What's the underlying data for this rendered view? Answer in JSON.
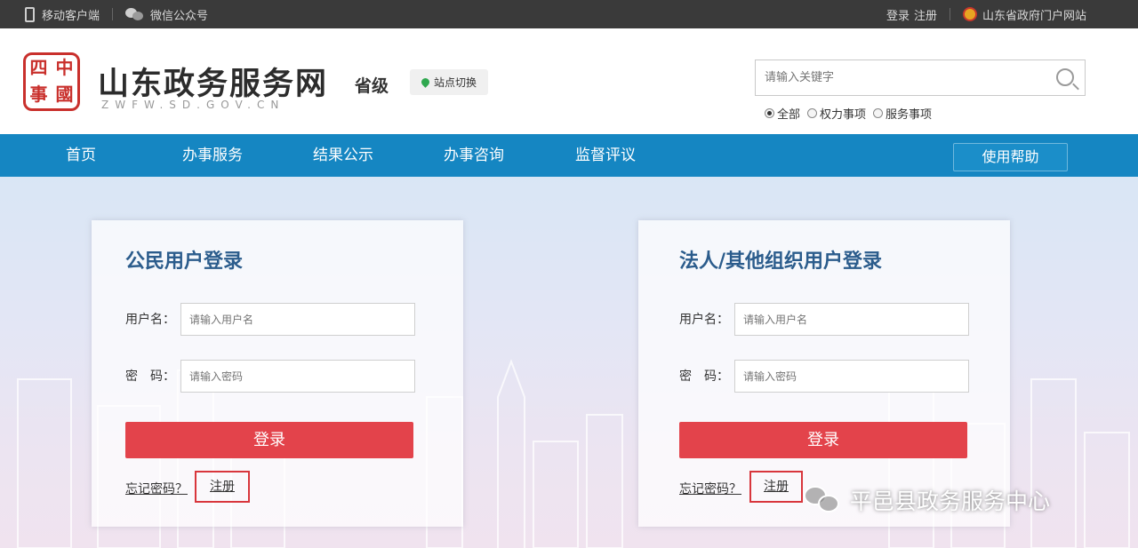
{
  "topbar": {
    "mobile_client": "移动客户端",
    "wechat": "微信公众号",
    "login": "登录",
    "register": "注册",
    "portal": "山东省政府门户网站"
  },
  "header": {
    "seal_chars": [
      "中",
      "國",
      "四",
      "事"
    ],
    "site_name": "山东政务服务网",
    "site_sub": "ZWFW.SD.GOV.CN",
    "level": "省级",
    "switch_label": "站点切换",
    "search_placeholder": "请输入关键字",
    "radios": [
      {
        "label": "全部",
        "checked": true
      },
      {
        "label": "权力事项",
        "checked": false
      },
      {
        "label": "服务事项",
        "checked": false
      }
    ]
  },
  "nav": {
    "items": [
      "首页",
      "办事服务",
      "结果公示",
      "办事咨询",
      "监督评议"
    ],
    "help": "使用帮助"
  },
  "citizen": {
    "title": "公民用户登录",
    "username_label": "用户名：",
    "username_placeholder": "请输入用户名",
    "password_label": "密　码：",
    "password_placeholder": "请输入密码",
    "login_button": "登录",
    "forgot": "忘记密码？",
    "register": "注册"
  },
  "legal": {
    "title": "法人/其他组织用户登录",
    "username_label": "用户名：",
    "username_placeholder": "请输入用户名",
    "password_label": "密　码：",
    "password_placeholder": "请输入密码",
    "login_button": "登录",
    "forgot": "忘记密码？",
    "register": "注册"
  },
  "watermark": "平邑县政务服务中心",
  "colors": {
    "nav_blue": "#1586c2",
    "login_red": "#e3434b",
    "title_blue": "#2b5c8c",
    "seal_red": "#c9302c"
  }
}
